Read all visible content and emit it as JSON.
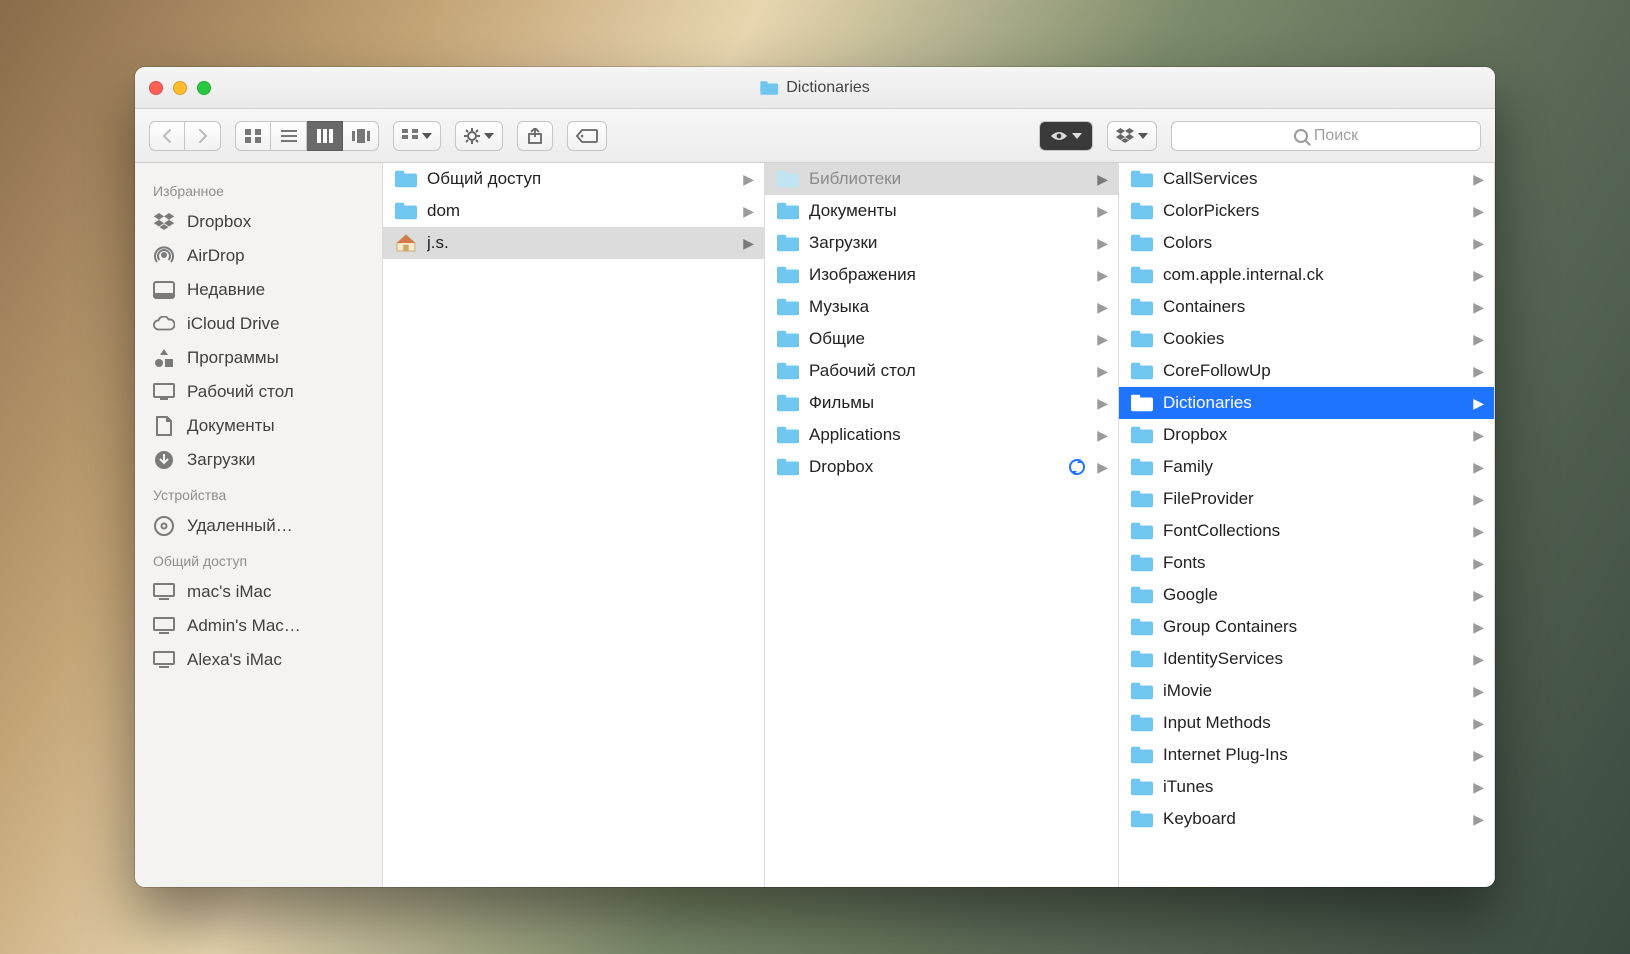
{
  "window_title": "Dictionaries",
  "search_placeholder": "Поиск",
  "sidebar": {
    "sections": [
      {
        "header": "Избранное",
        "items": [
          {
            "icon": "dropbox",
            "label": "Dropbox"
          },
          {
            "icon": "airdrop",
            "label": "AirDrop"
          },
          {
            "icon": "recents",
            "label": "Недавние"
          },
          {
            "icon": "icloud",
            "label": "iCloud Drive"
          },
          {
            "icon": "apps",
            "label": "Программы"
          },
          {
            "icon": "desktop",
            "label": "Рабочий стол"
          },
          {
            "icon": "documents",
            "label": "Документы"
          },
          {
            "icon": "downloads",
            "label": "Загрузки"
          }
        ]
      },
      {
        "header": "Устройства",
        "items": [
          {
            "icon": "disc",
            "label": "Удаленный…"
          }
        ]
      },
      {
        "header": "Общий доступ",
        "items": [
          {
            "icon": "computer",
            "label": " mac's iMac"
          },
          {
            "icon": "computer",
            "label": "Admin's Mac…"
          },
          {
            "icon": "computer",
            "label": "Alexa's iMac"
          }
        ]
      }
    ]
  },
  "columns": [
    {
      "items": [
        {
          "icon": "folder",
          "label": "Общий доступ",
          "arrow": true
        },
        {
          "icon": "folder",
          "label": "dom",
          "arrow": true
        },
        {
          "icon": "home",
          "label": "j.s.",
          "arrow": true,
          "selected": "path"
        }
      ]
    },
    {
      "items": [
        {
          "icon": "library",
          "label": "Библиотеки",
          "arrow": true,
          "selected": "path-dim"
        },
        {
          "icon": "folder-docs",
          "label": "Документы",
          "arrow": true
        },
        {
          "icon": "folder-dl",
          "label": "Загрузки",
          "arrow": true
        },
        {
          "icon": "folder-img",
          "label": "Изображения",
          "arrow": true
        },
        {
          "icon": "folder-music",
          "label": "Музыка",
          "arrow": true
        },
        {
          "icon": "folder-public",
          "label": "Общие",
          "arrow": true
        },
        {
          "icon": "folder-desktop",
          "label": "Рабочий стол",
          "arrow": true
        },
        {
          "icon": "folder-movies",
          "label": "Фильмы",
          "arrow": true
        },
        {
          "icon": "folder",
          "label": "Applications",
          "arrow": true
        },
        {
          "icon": "folder-dropbox",
          "label": "Dropbox",
          "arrow": true,
          "sync": true
        }
      ]
    },
    {
      "items": [
        {
          "icon": "folder",
          "label": "CallServices",
          "arrow": true
        },
        {
          "icon": "folder",
          "label": "ColorPickers",
          "arrow": true
        },
        {
          "icon": "folder",
          "label": "Colors",
          "arrow": true
        },
        {
          "icon": "folder",
          "label": "com.apple.internal.ck",
          "arrow": true
        },
        {
          "icon": "folder",
          "label": "Containers",
          "arrow": true
        },
        {
          "icon": "folder",
          "label": "Cookies",
          "arrow": true
        },
        {
          "icon": "folder",
          "label": "CoreFollowUp",
          "arrow": true
        },
        {
          "icon": "folder",
          "label": "Dictionaries",
          "arrow": true,
          "selected": "active"
        },
        {
          "icon": "folder",
          "label": "Dropbox",
          "arrow": true
        },
        {
          "icon": "folder",
          "label": "Family",
          "arrow": true
        },
        {
          "icon": "folder",
          "label": "FileProvider",
          "arrow": true
        },
        {
          "icon": "folder",
          "label": "FontCollections",
          "arrow": true
        },
        {
          "icon": "folder",
          "label": "Fonts",
          "arrow": true
        },
        {
          "icon": "folder",
          "label": "Google",
          "arrow": true
        },
        {
          "icon": "folder",
          "label": "Group Containers",
          "arrow": true
        },
        {
          "icon": "folder",
          "label": "IdentityServices",
          "arrow": true
        },
        {
          "icon": "folder",
          "label": "iMovie",
          "arrow": true
        },
        {
          "icon": "folder",
          "label": "Input Methods",
          "arrow": true
        },
        {
          "icon": "folder",
          "label": "Internet Plug-Ins",
          "arrow": true
        },
        {
          "icon": "folder",
          "label": "iTunes",
          "arrow": true
        },
        {
          "icon": "folder",
          "label": "Keyboard",
          "arrow": true
        }
      ]
    }
  ]
}
